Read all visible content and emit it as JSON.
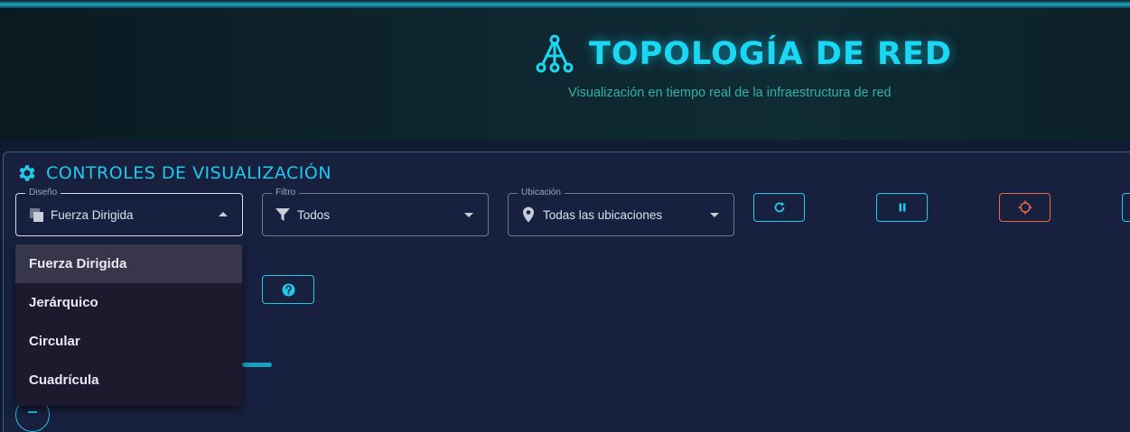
{
  "header": {
    "title": "TOPOLOGÍA DE RED",
    "subtitle": "Visualización en tiempo real de la infraestructura de red"
  },
  "controls": {
    "title": "CONTROLES DE VISUALIZACIÓN",
    "layout": {
      "label": "Diseño",
      "value": "Fuerza Dirigida",
      "open": true
    },
    "filter": {
      "label": "Filtro",
      "value": "Todos"
    },
    "location": {
      "label": "Ubicación",
      "value": "Todas las ubicaciones"
    },
    "buttons": [
      "refresh-icon",
      "pause-icon",
      "crosshair-icon",
      "help-icon"
    ]
  },
  "layout_options": [
    {
      "label": "Fuerza Dirigida",
      "selected": true
    },
    {
      "label": "Jerárquico",
      "selected": false
    },
    {
      "label": "Circular",
      "selected": false
    },
    {
      "label": "Cuadrícula",
      "selected": false
    }
  ],
  "colors": {
    "accent": "#22c8ea",
    "warning": "#e56a40",
    "panel": "#17213f",
    "subtitle": "#2fb3a6"
  }
}
